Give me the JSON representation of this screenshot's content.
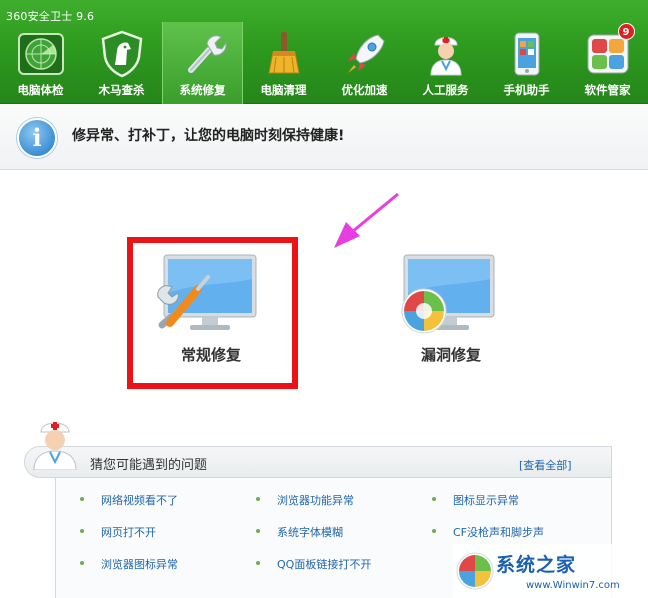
{
  "app": {
    "title": "360安全卫士 9.6"
  },
  "nav": {
    "items": [
      {
        "label": "电脑体检",
        "icon": "radar-icon",
        "active": false
      },
      {
        "label": "木马查杀",
        "icon": "horse-shield-icon",
        "active": false
      },
      {
        "label": "系统修复",
        "icon": "wrench-icon",
        "active": true
      },
      {
        "label": "电脑清理",
        "icon": "broom-icon",
        "active": false
      },
      {
        "label": "优化加速",
        "icon": "rocket-icon",
        "active": false
      },
      {
        "label": "人工服务",
        "icon": "doctor-icon",
        "active": false
      },
      {
        "label": "手机助手",
        "icon": "phone-icon",
        "active": false
      },
      {
        "label": "软件管家",
        "icon": "apps-icon",
        "active": false,
        "badge": "9"
      }
    ]
  },
  "info": {
    "text": "修异常、打补丁，让您的电脑时刻保持健康!"
  },
  "options": {
    "regular_repair": "常规修复",
    "vulnerability_repair": "漏洞修复"
  },
  "problems": {
    "title": "猜您可能遇到的问题",
    "view_all": "[查看全部]",
    "items": [
      "网络视频看不了",
      "浏览器功能异常",
      "图标显示异常",
      "网页打不开",
      "系统字体模糊",
      "CF没枪声和脚步声",
      "浏览器图标异常",
      "QQ面板链接打不开"
    ]
  },
  "watermark": {
    "brand": "系统之家",
    "url": "www.Winwin7.com"
  },
  "colors": {
    "header_green": "#2e9a1f",
    "highlight_red": "#ea1418",
    "arrow_magenta": "#e83ee0",
    "link_blue": "#2266aa"
  }
}
